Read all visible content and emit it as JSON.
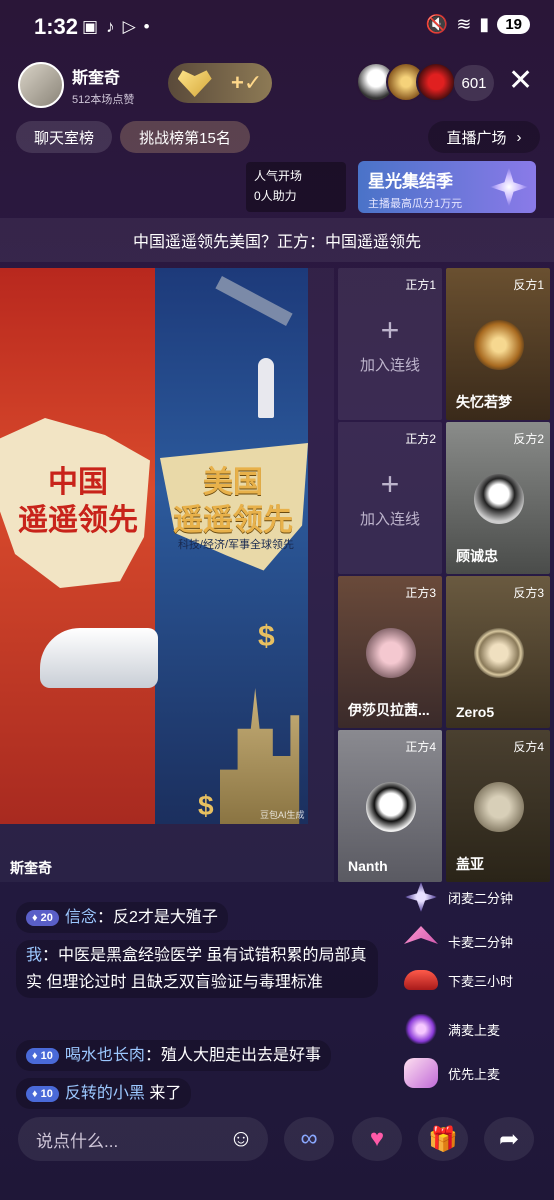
{
  "status": {
    "time": "1:32",
    "battery": "19"
  },
  "host": {
    "name": "斯奎奇",
    "likes": "512本场点赞"
  },
  "viewers": {
    "count": "601"
  },
  "tabs": {
    "rank": "聊天室榜",
    "challenge": "挑战榜第15名",
    "plaza": "直播广场"
  },
  "popularity": {
    "line1": "人气开场",
    "line2": "0人助力"
  },
  "starlight": {
    "title": "星光集结季",
    "subtitle": "主播最高瓜分1万元"
  },
  "topic": "中国遥遥领先美国？正方：中国遥遥领先",
  "poster": {
    "cn_line1": "中国",
    "cn_line2": "遥遥领先",
    "us_line1": "美国",
    "us_line2": "遥遥领先",
    "us_sub": "科技/经济/军事全球领先",
    "watermark": "豆包AI生成"
  },
  "stage_name": "斯奎奇",
  "slots": [
    {
      "tag": "正方1",
      "empty": true,
      "add": "加入连线"
    },
    {
      "tag": "反方1",
      "empty": false,
      "name": "失忆若梦"
    },
    {
      "tag": "正方2",
      "empty": true,
      "add": "加入连线"
    },
    {
      "tag": "反方2",
      "empty": false,
      "name": "顾诚忠"
    },
    {
      "tag": "正方3",
      "empty": false,
      "name": "伊莎贝拉茜..."
    },
    {
      "tag": "反方3",
      "empty": false,
      "name": "Zero5"
    },
    {
      "tag": "正方4",
      "empty": false,
      "name": "Nanth"
    },
    {
      "tag": "反方4",
      "empty": false,
      "name": "盖亚"
    }
  ],
  "gifts": [
    {
      "label": "闭麦二分钟",
      "icon": "star-gift-icon"
    },
    {
      "label": "卡麦二分钟",
      "icon": "crane-gift-icon"
    },
    {
      "label": "下麦三小时",
      "icon": "car-gift-icon"
    },
    {
      "label": "满麦上麦",
      "icon": "firework-gift-icon"
    },
    {
      "label": "优先上麦",
      "icon": "hand-gift-icon"
    }
  ],
  "chat": [
    {
      "level": "20",
      "user": "信念",
      "text": "反2才是大殖子"
    },
    {
      "user": "我",
      "text": "中医是黑盒经验医学 虽有试错积累的局部真实 但理论过时 且缺乏双盲验证与毒理标准"
    },
    {
      "level": "10",
      "user": "喝水也长肉",
      "text": "殖人大胆走出去是好事"
    },
    {
      "level": "10",
      "user": "反转的小黑",
      "text": "来了"
    }
  ],
  "input": {
    "placeholder": "说点什么..."
  }
}
